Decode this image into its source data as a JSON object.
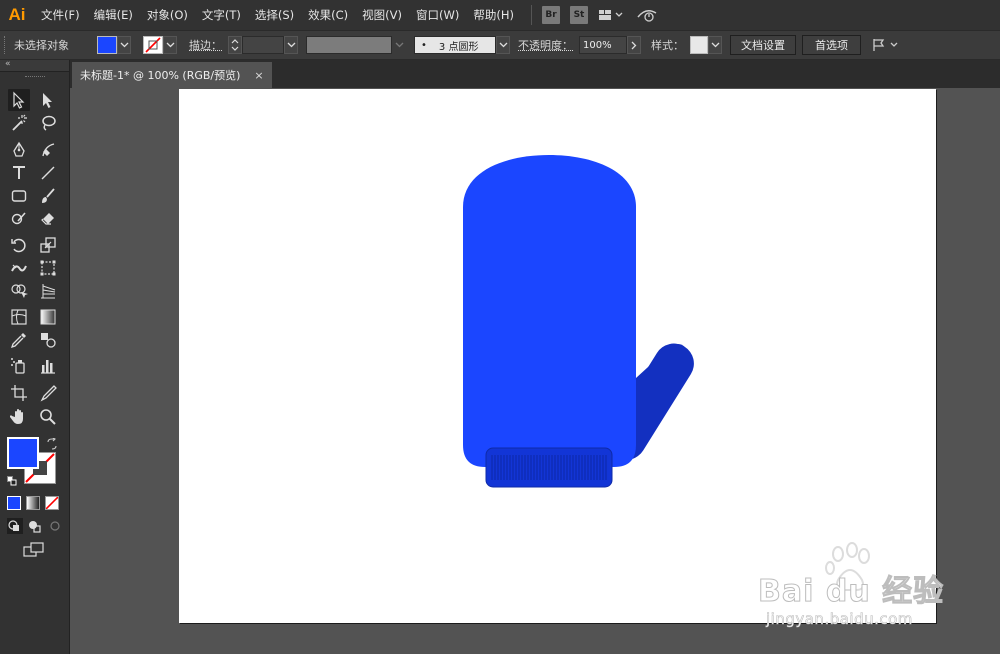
{
  "app": {
    "logo_text": "Ai"
  },
  "menu": [
    "文件(F)",
    "编辑(E)",
    "对象(O)",
    "文字(T)",
    "选择(S)",
    "效果(C)",
    "视图(V)",
    "窗口(W)",
    "帮助(H)"
  ],
  "app_buttons": {
    "bridge": "Br",
    "stock": "St"
  },
  "control_bar": {
    "selection_status": "未选择对象",
    "stroke_label": "描边：",
    "brush_dot": "•",
    "brush_value": "3 点圆形",
    "opacity_label": "不透明度：",
    "opacity_value": "100%",
    "style_label": "样式：",
    "doc_setup_button": "文档设置",
    "preferences_button": "首选项"
  },
  "document_tab": {
    "title": "未标题-1* @ 100% (RGB/预览)",
    "close": "×"
  },
  "colors": {
    "fill": "#1b46ff",
    "thumb": "#1330c0",
    "cuff": "#1235d6",
    "cuff_border": "#0e2aa8",
    "stroke_none": "#ff0000",
    "ui_dark": "#323232",
    "canvas": "#535353",
    "logo": "#ff9a00"
  },
  "watermark": {
    "brand": "Bai du 经验",
    "url": "jingyan.baidu.com"
  },
  "tools": [
    "selection-tool",
    "direct-selection-tool",
    "magic-wand-tool",
    "lasso-tool",
    "pen-tool",
    "curvature-tool",
    "type-tool",
    "line-tool",
    "rectangle-tool",
    "paintbrush-tool",
    "shaper-tool",
    "eraser-tool",
    "rotate-tool",
    "scale-tool",
    "width-tool",
    "free-transform-tool",
    "shape-builder-tool",
    "perspective-grid-tool",
    "mesh-tool",
    "gradient-tool",
    "eyedropper-tool",
    "blend-tool",
    "symbol-sprayer-tool",
    "column-graph-tool",
    "artboard-tool",
    "slice-tool",
    "hand-tool",
    "zoom-tool"
  ]
}
